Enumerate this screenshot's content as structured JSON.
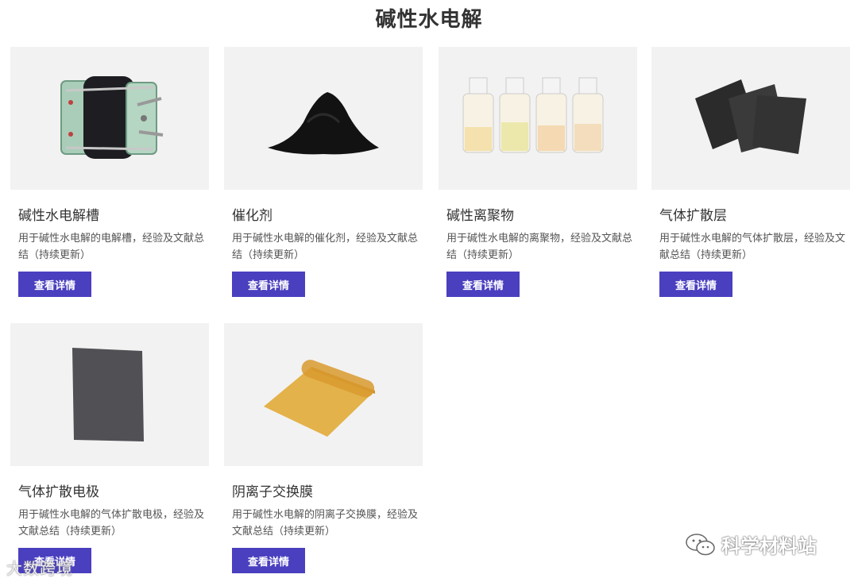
{
  "page": {
    "title": "碱性水电解"
  },
  "cards": [
    {
      "title": "碱性水电解槽",
      "desc": "用于碱性水电解的电解槽，经验及文献总结（持续更新）",
      "button": "查看详情",
      "image_icon": "electrolyzer-stack-icon"
    },
    {
      "title": "催化剂",
      "desc": "用于碱性水电解的催化剂，经验及文献总结（持续更新）",
      "button": "查看详情",
      "image_icon": "catalyst-powder-icon"
    },
    {
      "title": "碱性离聚物",
      "desc": "用于碱性水电解的离聚物，经验及文献总结（持续更新）",
      "button": "查看详情",
      "image_icon": "ionomer-bottles-icon"
    },
    {
      "title": "气体扩散层",
      "desc": "用于碱性水电解的气体扩散层，经验及文献总结（持续更新）",
      "button": "查看详情",
      "image_icon": "gas-diffusion-layer-icon"
    },
    {
      "title": "气体扩散电极",
      "desc": "用于碱性水电解的气体扩散电极，经验及文献总结（持续更新）",
      "button": "查看详情",
      "image_icon": "gas-diffusion-electrode-icon"
    },
    {
      "title": "阴离子交换膜",
      "desc": "用于碱性水电解的阴离子交换膜，经验及文献总结（持续更新）",
      "button": "查看详情",
      "image_icon": "membrane-sheet-icon"
    }
  ],
  "watermarks": {
    "left": "大数跨境",
    "right": "科学材料站"
  },
  "colors": {
    "button": "#4a3fbf",
    "thumb_bg": "#f2f2f2",
    "text": "#333333"
  }
}
